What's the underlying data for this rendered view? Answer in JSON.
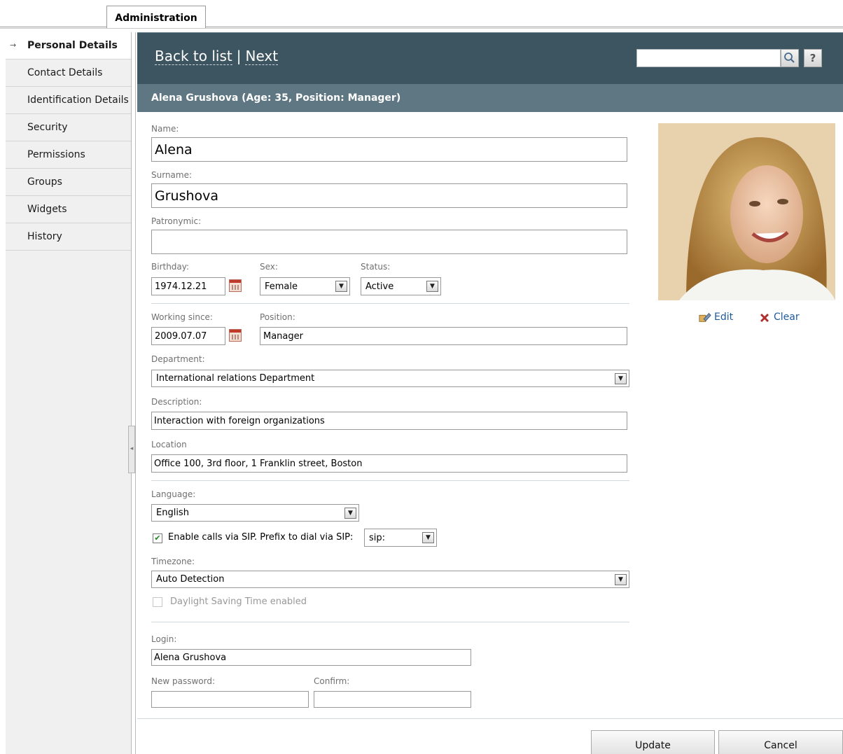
{
  "tabs": {
    "admin": "Administration"
  },
  "sidebar": {
    "items": [
      {
        "label": "Personal Details",
        "active": true
      },
      {
        "label": "Contact Details"
      },
      {
        "label": "Identification Details"
      },
      {
        "label": "Security"
      },
      {
        "label": "Permissions"
      },
      {
        "label": "Groups"
      },
      {
        "label": "Widgets"
      },
      {
        "label": "History"
      }
    ]
  },
  "header": {
    "back_label": "Back to list",
    "separator": "|",
    "next_label": "Next",
    "search_value": "",
    "help_label": "?",
    "subtitle": "Alena Grushova (Age: 35, Position: Manager)"
  },
  "form": {
    "name_label": "Name:",
    "name_value": "Alena",
    "surname_label": "Surname:",
    "surname_value": "Grushova",
    "patronymic_label": "Patronymic:",
    "patronymic_value": "",
    "birthday_label": "Birthday:",
    "birthday_value": "1974.12.21",
    "sex_label": "Sex:",
    "sex_value": "Female",
    "status_label": "Status:",
    "status_value": "Active",
    "working_since_label": "Working since:",
    "working_since_value": "2009.07.07",
    "position_label": "Position:",
    "position_value": "Manager",
    "department_label": "Department:",
    "department_value": "International relations Department",
    "description_label": "Description:",
    "description_value": "Interaction with foreign organizations",
    "location_label": "Location",
    "location_value": "Office 100, 3rd floor, 1 Franklin street, Boston",
    "language_label": "Language:",
    "language_value": "English",
    "sip_label": "Enable calls via SIP. Prefix to dial via SIP:",
    "sip_checked": true,
    "sip_prefix_value": "sip:",
    "timezone_label": "Timezone:",
    "timezone_value": "Auto Detection",
    "dst_label": "Daylight Saving Time enabled",
    "dst_checked": false,
    "login_label": "Login:",
    "login_value": "Alena Grushova",
    "new_password_label": "New password:",
    "confirm_label": "Confirm:"
  },
  "photo": {
    "edit_label": "Edit",
    "clear_label": "Clear"
  },
  "buttons": {
    "update": "Update",
    "cancel": "Cancel"
  }
}
